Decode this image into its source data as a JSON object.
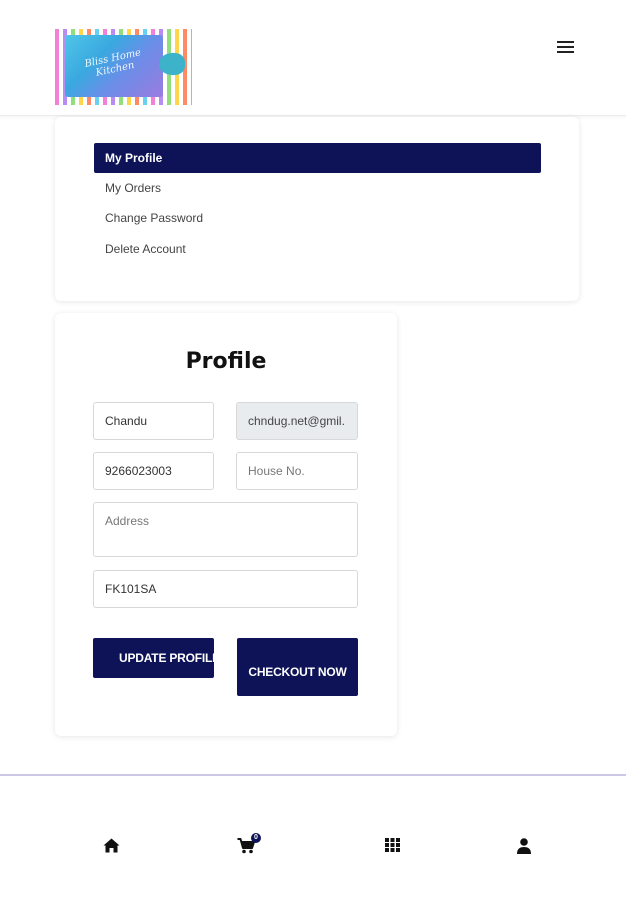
{
  "header": {
    "logo_text": "Bliss Home Kitchen",
    "menu_icon": "hamburger-menu-icon"
  },
  "sidebar": {
    "items": [
      {
        "label": "My Profile",
        "active": true
      },
      {
        "label": "My Orders",
        "active": false
      },
      {
        "label": "Change Password",
        "active": false
      },
      {
        "label": "Delete Account",
        "active": false
      }
    ]
  },
  "profile": {
    "title": "Profile",
    "fields": {
      "name": {
        "value": "Chandu"
      },
      "email": {
        "value": "chndug.net@gmil."
      },
      "phone": {
        "value": "9266023003"
      },
      "house_no": {
        "value": "",
        "placeholder": "House No."
      },
      "address": {
        "value": "",
        "placeholder": "Address"
      },
      "postcode": {
        "value": "FK101SA"
      }
    },
    "buttons": {
      "update": "UPDATE PROFILE",
      "checkout": "CHECKOUT NOW"
    }
  },
  "bottom_nav": {
    "items": [
      {
        "icon": "home-icon"
      },
      {
        "icon": "cart-icon",
        "badge": "0"
      },
      {
        "icon": "grid-icon"
      },
      {
        "icon": "user-icon"
      }
    ]
  },
  "colors": {
    "accent": "#0e1358",
    "footer_line": "#cbc8e6"
  }
}
